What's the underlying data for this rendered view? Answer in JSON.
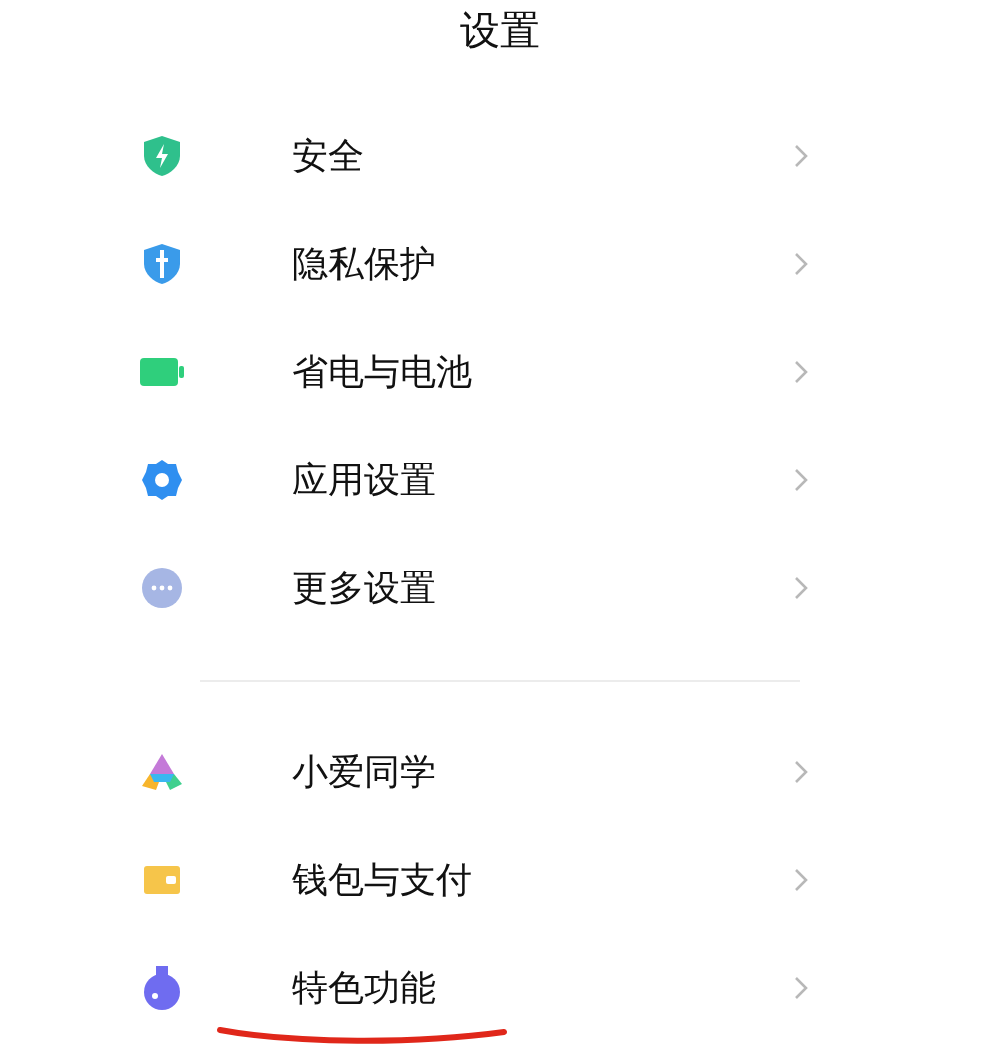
{
  "title": "设置",
  "sections": [
    {
      "items": [
        {
          "label": "安全",
          "annotated": false
        },
        {
          "label": "隐私保护",
          "annotated": false
        },
        {
          "label": "省电与电池",
          "annotated": false
        },
        {
          "label": "应用设置",
          "annotated": false
        },
        {
          "label": "更多设置",
          "annotated": false
        }
      ]
    },
    {
      "items": [
        {
          "label": "小爱同学",
          "annotated": false
        },
        {
          "label": "钱包与支付",
          "annotated": false
        },
        {
          "label": "特色功能",
          "annotated": true
        }
      ]
    }
  ]
}
